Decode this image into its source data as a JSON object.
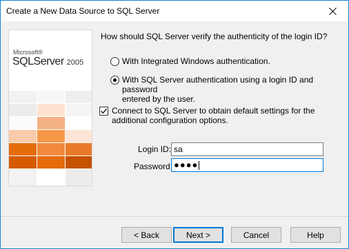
{
  "window": {
    "title": "Create a New Data Source to SQL Server"
  },
  "banner": {
    "brand_small": "Microsoft®",
    "brand_large": "SQLServer",
    "brand_year": "2005",
    "accent_colors": [
      "#f79646",
      "#e46c0a",
      "#d55b00",
      "#f4a460",
      "#e8e8e8"
    ]
  },
  "auth": {
    "question": "How should SQL Server verify the authenticity of the login ID?",
    "options": [
      {
        "label": "With Integrated Windows authentication.",
        "selected": false
      },
      {
        "label_line1": "With SQL Server authentication using a login ID and password",
        "label_line2": "entered by the user.",
        "selected": true
      }
    ]
  },
  "connect": {
    "label_line1": "Connect to SQL Server to obtain default settings for the",
    "label_line2": "additional configuration options.",
    "checked": true
  },
  "login": {
    "login_id_label": "Login ID:",
    "login_id_value": "sa",
    "password_label": "Password:",
    "password_masked": "●●●●"
  },
  "buttons": {
    "back": "< Back",
    "next": "Next >",
    "cancel": "Cancel",
    "help": "Help"
  },
  "icons": {
    "close": "close-icon",
    "check": "checkmark-icon"
  }
}
